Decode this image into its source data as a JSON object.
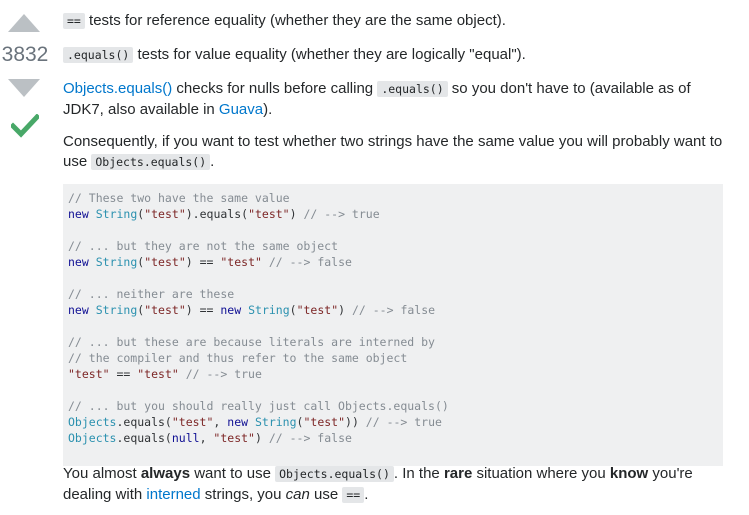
{
  "vote": {
    "count": "3832",
    "up_icon": "triangle-up",
    "down_icon": "triangle-down",
    "accepted_icon": "checkmark",
    "accepted_color": "#48a868",
    "arrow_color": "#bbc0c4"
  },
  "answer": {
    "p1": {
      "code": "==",
      "text": " tests for reference equality (whether they are the same object)."
    },
    "p2": {
      "code": ".equals()",
      "text": " tests for value equality (whether they are logically \"equal\")."
    },
    "p3": {
      "link1": "Objects.equals()",
      "text1": " checks for nulls before calling ",
      "code": ".equals()",
      "text2": " so you don't have to (available as of JDK7, also available in ",
      "link2": "Guava",
      "text3": ")."
    },
    "p4": {
      "text1": "Consequently, if you want to test whether two strings have the same value you will probably want to use ",
      "code": "Objects.equals()",
      "text2": "."
    },
    "code_block": {
      "lines": [
        [
          {
            "t": "// These two have the same value",
            "c": "cm"
          }
        ],
        [
          {
            "t": "new",
            "c": "kw"
          },
          {
            "t": " ",
            "c": "pl"
          },
          {
            "t": "String",
            "c": "ty"
          },
          {
            "t": "(",
            "c": "pl"
          },
          {
            "t": "\"test\"",
            "c": "st"
          },
          {
            "t": ").equals(",
            "c": "pl"
          },
          {
            "t": "\"test\"",
            "c": "st"
          },
          {
            "t": ") ",
            "c": "pl"
          },
          {
            "t": "// --> true",
            "c": "cm"
          }
        ],
        [],
        [
          {
            "t": "// ... but they are not the same object",
            "c": "cm"
          }
        ],
        [
          {
            "t": "new",
            "c": "kw"
          },
          {
            "t": " ",
            "c": "pl"
          },
          {
            "t": "String",
            "c": "ty"
          },
          {
            "t": "(",
            "c": "pl"
          },
          {
            "t": "\"test\"",
            "c": "st"
          },
          {
            "t": ") == ",
            "c": "pl"
          },
          {
            "t": "\"test\"",
            "c": "st"
          },
          {
            "t": " ",
            "c": "pl"
          },
          {
            "t": "// --> false",
            "c": "cm"
          }
        ],
        [],
        [
          {
            "t": "// ... neither are these",
            "c": "cm"
          }
        ],
        [
          {
            "t": "new",
            "c": "kw"
          },
          {
            "t": " ",
            "c": "pl"
          },
          {
            "t": "String",
            "c": "ty"
          },
          {
            "t": "(",
            "c": "pl"
          },
          {
            "t": "\"test\"",
            "c": "st"
          },
          {
            "t": ") == ",
            "c": "pl"
          },
          {
            "t": "new",
            "c": "kw"
          },
          {
            "t": " ",
            "c": "pl"
          },
          {
            "t": "String",
            "c": "ty"
          },
          {
            "t": "(",
            "c": "pl"
          },
          {
            "t": "\"test\"",
            "c": "st"
          },
          {
            "t": ") ",
            "c": "pl"
          },
          {
            "t": "// --> false",
            "c": "cm"
          }
        ],
        [],
        [
          {
            "t": "// ... but these are because literals are interned by",
            "c": "cm"
          }
        ],
        [
          {
            "t": "// the compiler and thus refer to the same object",
            "c": "cm"
          }
        ],
        [
          {
            "t": "\"test\"",
            "c": "st"
          },
          {
            "t": " == ",
            "c": "pl"
          },
          {
            "t": "\"test\"",
            "c": "st"
          },
          {
            "t": " ",
            "c": "pl"
          },
          {
            "t": "// --> true",
            "c": "cm"
          }
        ],
        [],
        [
          {
            "t": "// ... but you should really just call Objects.equals()",
            "c": "cm"
          }
        ],
        [
          {
            "t": "Objects",
            "c": "ty"
          },
          {
            "t": ".equals(",
            "c": "pl"
          },
          {
            "t": "\"test\"",
            "c": "st"
          },
          {
            "t": ", ",
            "c": "pl"
          },
          {
            "t": "new",
            "c": "kw"
          },
          {
            "t": " ",
            "c": "pl"
          },
          {
            "t": "String",
            "c": "ty"
          },
          {
            "t": "(",
            "c": "pl"
          },
          {
            "t": "\"test\"",
            "c": "st"
          },
          {
            "t": ")) ",
            "c": "pl"
          },
          {
            "t": "// --> true",
            "c": "cm"
          }
        ],
        [
          {
            "t": "Objects",
            "c": "ty"
          },
          {
            "t": ".equals(",
            "c": "pl"
          },
          {
            "t": "null",
            "c": "kw"
          },
          {
            "t": ", ",
            "c": "pl"
          },
          {
            "t": "\"test\"",
            "c": "st"
          },
          {
            "t": ") ",
            "c": "pl"
          },
          {
            "t": "// --> false",
            "c": "cm"
          }
        ]
      ]
    },
    "p5": {
      "text1": "You almost ",
      "bold1": "always",
      "text2": " want to use ",
      "code1": "Objects.equals()",
      "text3": ". In the ",
      "bold2": "rare",
      "text4": " situation where you ",
      "bold3": "know",
      "text5": " you're dealing with ",
      "link": "interned",
      "text6": " strings, you ",
      "em": "can",
      "text7": " use ",
      "code2": "==",
      "text8": "."
    }
  },
  "colors": {
    "link": "#0077cc",
    "code_bg": "#eff0f1",
    "inline_code_bg": "#e4e6e8",
    "text": "#242729"
  }
}
